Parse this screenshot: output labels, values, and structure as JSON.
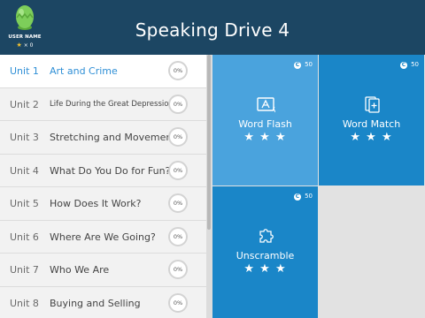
{
  "header": {
    "title": "Speaking Drive 4",
    "user_name": "USER NAME",
    "star_count": "× 0"
  },
  "units": [
    {
      "num": "Unit 1",
      "name": "Art and Crime",
      "progress": "0%",
      "selected": true
    },
    {
      "num": "Unit 2",
      "name": "Life During the Great Depression",
      "progress": "0%",
      "selected": false
    },
    {
      "num": "Unit 3",
      "name": "Stretching and Movement",
      "progress": "0%",
      "selected": false
    },
    {
      "num": "Unit 4",
      "name": "What Do You Do for Fun?",
      "progress": "0%",
      "selected": false
    },
    {
      "num": "Unit 5",
      "name": "How Does It Work?",
      "progress": "0%",
      "selected": false
    },
    {
      "num": "Unit 6",
      "name": "Where Are We Going?",
      "progress": "0%",
      "selected": false
    },
    {
      "num": "Unit 7",
      "name": "Who We Are",
      "progress": "0%",
      "selected": false
    },
    {
      "num": "Unit 8",
      "name": "Buying and Selling",
      "progress": "0%",
      "selected": false
    }
  ],
  "activities": [
    {
      "label": "Word Flash",
      "coins": "50",
      "stars": "★ ★ ★",
      "icon": "word-flash-icon",
      "color": "#4aa3dd"
    },
    {
      "label": "Word Match",
      "coins": "50",
      "stars": "★ ★ ★",
      "icon": "word-match-icon",
      "color": "#1a86c8"
    },
    {
      "label": "Unscramble",
      "coins": "50",
      "stars": "★ ★ ★",
      "icon": "puzzle-icon",
      "color": "#1a86c8"
    }
  ],
  "coin_symbol": "C",
  "colors": {
    "header": "#1c4663",
    "accent": "#2f8fd6",
    "tile_light": "#4aa3dd",
    "tile_dark": "#1a86c8",
    "avatar": "#7dce5a"
  }
}
